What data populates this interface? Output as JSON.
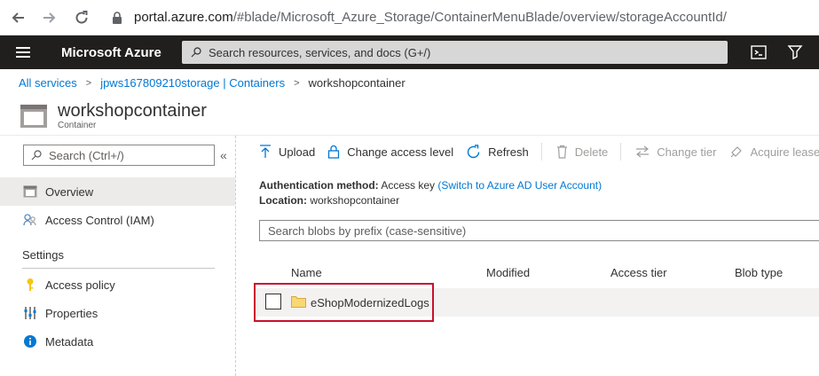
{
  "browser": {
    "url_host": "portal.azure.com",
    "url_path": "/#blade/Microsoft_Azure_Storage/ContainerMenuBlade/overview/storageAccountId/"
  },
  "topbar": {
    "brand": "Microsoft Azure",
    "search_placeholder": "Search resources, services, and docs (G+/)"
  },
  "breadcrumb": {
    "items": [
      "All services",
      "jpws167809210storage | Containers"
    ],
    "current": "workshopcontainer"
  },
  "resource": {
    "title": "workshopcontainer",
    "subtitle": "Container"
  },
  "sidebar": {
    "search_placeholder": "Search (Ctrl+/)",
    "collapse": "«",
    "items": [
      {
        "label": "Overview",
        "icon": "container-icon"
      },
      {
        "label": "Access Control (IAM)",
        "icon": "people-icon"
      }
    ],
    "section": "Settings",
    "settings_items": [
      {
        "label": "Access policy",
        "icon": "key-icon"
      },
      {
        "label": "Properties",
        "icon": "sliders-icon"
      },
      {
        "label": "Metadata",
        "icon": "info-icon"
      }
    ]
  },
  "toolbar": {
    "upload": "Upload",
    "change_access": "Change access level",
    "refresh": "Refresh",
    "delete": "Delete",
    "change_tier": "Change tier",
    "acquire_lease": "Acquire lease"
  },
  "info": {
    "auth_label": "Authentication method:",
    "auth_value": "Access key",
    "auth_link": "(Switch to Azure AD User Account)",
    "location_label": "Location:",
    "location_value": "workshopcontainer"
  },
  "blob_search_placeholder": "Search blobs by prefix (case-sensitive)",
  "table": {
    "columns": [
      "Name",
      "Modified",
      "Access tier",
      "Blob type"
    ],
    "rows": [
      {
        "name": "eShopModernizedLogs",
        "type": "folder"
      }
    ]
  },
  "colors": {
    "accent": "#0078d4",
    "topbar_bg": "#201f1e",
    "highlight_border": "#c8102e",
    "folder": "#f8d775"
  }
}
